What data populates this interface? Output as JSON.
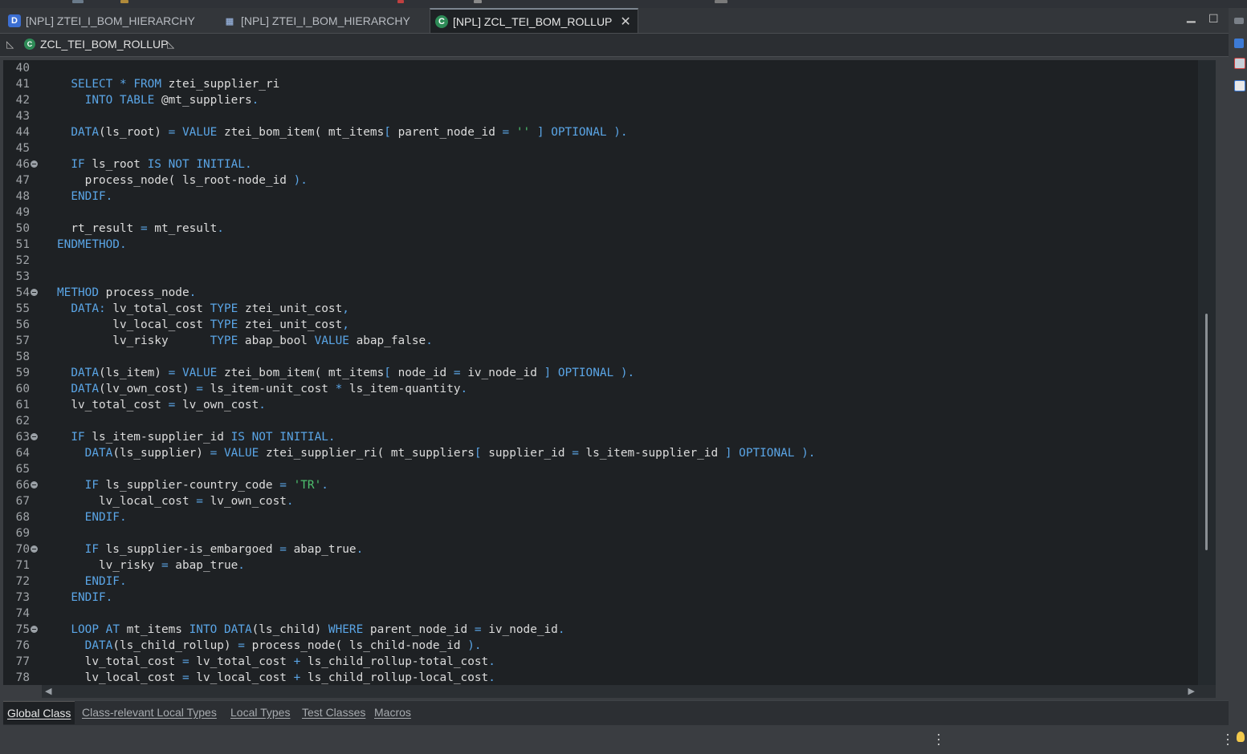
{
  "tabs": [
    {
      "icon": "ddic-icon",
      "label": "[NPL] ZTEI_I_BOM_HIERARCHY"
    },
    {
      "icon": "table-grid-icon",
      "label": "[NPL] ZTEI_I_BOM_HIERARCHY"
    },
    {
      "icon": "class-icon",
      "label": "[NPL] ZCL_TEI_BOM_ROLLUP",
      "active": true
    }
  ],
  "breadcrumb": {
    "label": "ZCL_TEI_BOM_ROLLUP"
  },
  "editor": {
    "lines": [
      {
        "n": "40",
        "fold": false,
        "code": ""
      },
      {
        "n": "41",
        "fold": false,
        "code": "  <span class=\"kw\">SELECT</span> <span class=\"kw\">*</span> <span class=\"kw\">FROM</span> ztei_supplier_ri"
      },
      {
        "n": "42",
        "fold": false,
        "code": "    <span class=\"kw\">INTO</span> <span class=\"kw\">TABLE</span> @mt_suppliers<span class=\"kw\">.</span>"
      },
      {
        "n": "43",
        "fold": false,
        "code": ""
      },
      {
        "n": "44",
        "fold": false,
        "code": "  <span class=\"kw\">DATA</span>(ls_root) <span class=\"kw\">=</span> <span class=\"kw\">VALUE</span> ztei_bom_item( mt_items<span class=\"kw\">[</span> parent_node_id <span class=\"kw\">=</span> <span class=\"str\">''</span> <span class=\"kw\">]</span> <span class=\"kw\">OPTIONAL</span> <span class=\"kw\">).</span>"
      },
      {
        "n": "45",
        "fold": false,
        "code": ""
      },
      {
        "n": "46",
        "fold": true,
        "code": "  <span class=\"kw\">IF</span> ls_root <span class=\"kw\">IS</span> <span class=\"kw\">NOT</span> <span class=\"kw\">INITIAL.</span>"
      },
      {
        "n": "47",
        "fold": false,
        "code": "    process_node( ls_root-node_id <span class=\"kw\">).</span>"
      },
      {
        "n": "48",
        "fold": false,
        "code": "  <span class=\"kw\">ENDIF.</span>"
      },
      {
        "n": "49",
        "fold": false,
        "code": ""
      },
      {
        "n": "50",
        "fold": false,
        "code": "  rt_result <span class=\"kw\">=</span> mt_result<span class=\"kw\">.</span>"
      },
      {
        "n": "51",
        "fold": false,
        "code": "<span class=\"kw\">ENDMETHOD.</span>"
      },
      {
        "n": "52",
        "fold": false,
        "code": ""
      },
      {
        "n": "53",
        "fold": false,
        "code": ""
      },
      {
        "n": "54",
        "fold": true,
        "code": "<span class=\"kw\">METHOD</span> process_node<span class=\"kw\">.</span>"
      },
      {
        "n": "55",
        "fold": false,
        "code": "  <span class=\"kw\">DATA:</span> lv_total_cost <span class=\"kw\">TYPE</span> ztei_unit_cost<span class=\"kw\">,</span>"
      },
      {
        "n": "56",
        "fold": false,
        "code": "        lv_local_cost <span class=\"kw\">TYPE</span> ztei_unit_cost<span class=\"kw\">,</span>"
      },
      {
        "n": "57",
        "fold": false,
        "code": "        lv_risky      <span class=\"kw\">TYPE</span> abap_bool <span class=\"kw\">VALUE</span> abap_false<span class=\"kw\">.</span>"
      },
      {
        "n": "58",
        "fold": false,
        "code": ""
      },
      {
        "n": "59",
        "fold": false,
        "code": "  <span class=\"kw\">DATA</span>(ls_item) <span class=\"kw\">=</span> <span class=\"kw\">VALUE</span> ztei_bom_item( mt_items<span class=\"kw\">[</span> node_id <span class=\"kw\">=</span> iv_node_id <span class=\"kw\">]</span> <span class=\"kw\">OPTIONAL</span> <span class=\"kw\">).</span>"
      },
      {
        "n": "60",
        "fold": false,
        "code": "  <span class=\"kw\">DATA</span>(lv_own_cost) <span class=\"kw\">=</span> ls_item-unit_cost <span class=\"kw\">*</span> ls_item-quantity<span class=\"kw\">.</span>"
      },
      {
        "n": "61",
        "fold": false,
        "code": "  lv_total_cost <span class=\"kw\">=</span> lv_own_cost<span class=\"kw\">.</span>"
      },
      {
        "n": "62",
        "fold": false,
        "code": ""
      },
      {
        "n": "63",
        "fold": true,
        "code": "  <span class=\"kw\">IF</span> ls_item-supplier_id <span class=\"kw\">IS</span> <span class=\"kw\">NOT</span> <span class=\"kw\">INITIAL.</span>"
      },
      {
        "n": "64",
        "fold": false,
        "code": "    <span class=\"kw\">DATA</span>(ls_supplier) <span class=\"kw\">=</span> <span class=\"kw\">VALUE</span> ztei_supplier_ri( mt_suppliers<span class=\"kw\">[</span> supplier_id <span class=\"kw\">=</span> ls_item-supplier_id <span class=\"kw\">]</span> <span class=\"kw\">OPTIONAL</span> <span class=\"kw\">).</span>"
      },
      {
        "n": "65",
        "fold": false,
        "code": ""
      },
      {
        "n": "66",
        "fold": true,
        "code": "    <span class=\"kw\">IF</span> ls_supplier-country_code <span class=\"kw\">=</span> <span class=\"str\">'TR'</span><span class=\"kw\">.</span>"
      },
      {
        "n": "67",
        "fold": false,
        "code": "      lv_local_cost <span class=\"kw\">=</span> lv_own_cost<span class=\"kw\">.</span>"
      },
      {
        "n": "68",
        "fold": false,
        "code": "    <span class=\"kw\">ENDIF.</span>"
      },
      {
        "n": "69",
        "fold": false,
        "code": ""
      },
      {
        "n": "70",
        "fold": true,
        "code": "    <span class=\"kw\">IF</span> ls_supplier-is_embargoed <span class=\"kw\">=</span> abap_true<span class=\"kw\">.</span>"
      },
      {
        "n": "71",
        "fold": false,
        "code": "      lv_risky <span class=\"kw\">=</span> abap_true<span class=\"kw\">.</span>"
      },
      {
        "n": "72",
        "fold": false,
        "code": "    <span class=\"kw\">ENDIF.</span>"
      },
      {
        "n": "73",
        "fold": false,
        "code": "  <span class=\"kw\">ENDIF.</span>"
      },
      {
        "n": "74",
        "fold": false,
        "code": ""
      },
      {
        "n": "75",
        "fold": true,
        "code": "  <span class=\"kw\">LOOP</span> <span class=\"kw\">AT</span> mt_items <span class=\"kw\">INTO</span> <span class=\"kw\">DATA</span>(ls_child) <span class=\"kw\">WHERE</span> parent_node_id <span class=\"kw\">=</span> iv_node_id<span class=\"kw\">.</span>"
      },
      {
        "n": "76",
        "fold": false,
        "code": "    <span class=\"kw\">DATA</span>(ls_child_rollup) <span class=\"kw\">=</span> process_node( ls_child-node_id <span class=\"kw\">).</span>"
      },
      {
        "n": "77",
        "fold": false,
        "code": "    lv_total_cost <span class=\"kw\">=</span> lv_total_cost <span class=\"kw\">+</span> ls_child_rollup-total_cost<span class=\"kw\">.</span>"
      },
      {
        "n": "78",
        "fold": false,
        "code": "    lv_local_cost <span class=\"kw\">=</span> lv_local_cost <span class=\"kw\">+</span> ls_child_rollup-local_cost<span class=\"kw\">.</span>"
      }
    ]
  },
  "bottom_tabs": [
    {
      "label": "Global Class",
      "active": true
    },
    {
      "label": "Class-relevant Local Types"
    },
    {
      "label": "Local Types"
    },
    {
      "label": "Test Classes"
    },
    {
      "label": "Macros"
    }
  ],
  "colors": {
    "keyword": "#5aa5e6",
    "string": "#4ec06e",
    "editor_bg": "#1e2124"
  }
}
